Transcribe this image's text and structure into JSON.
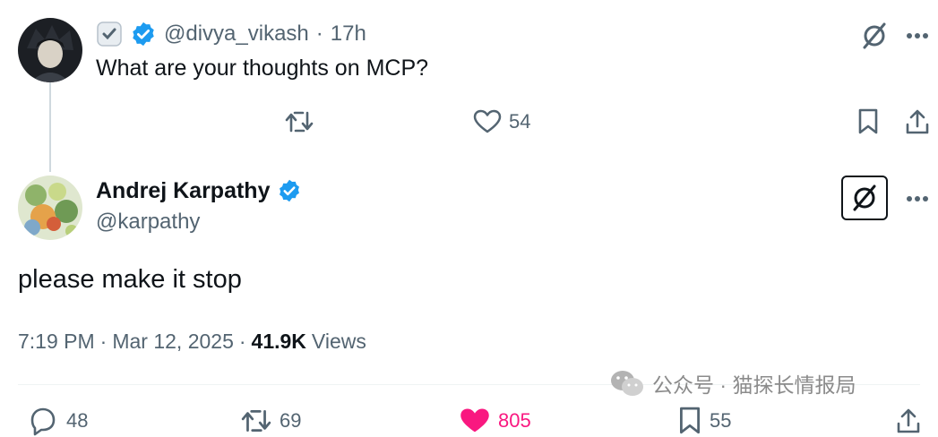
{
  "parent_tweet": {
    "handle": "@divya_vikash",
    "separator": "·",
    "time": "17h",
    "text": "What are your thoughts on MCP?",
    "likes": "54"
  },
  "main_tweet": {
    "name": "Andrej Karpathy",
    "handle": "@karpathy",
    "text": "please make it stop",
    "time": "7:19 PM",
    "sep1": "·",
    "date": "Mar 12, 2025",
    "sep2": "·",
    "views_count": "41.9K",
    "views_label": "Views"
  },
  "bottom_actions": {
    "replies": "48",
    "retweets": "69",
    "likes": "805",
    "bookmarks": "55"
  },
  "watermark": {
    "text": "公众号 · 猫探长情报局"
  },
  "colors": {
    "verified": "#1d9bf0",
    "like_active": "#f91880",
    "muted": "#536471"
  },
  "icons": [
    "verified-icon",
    "grok-icon",
    "more-icon",
    "retweet-icon",
    "heart-icon",
    "bookmark-icon",
    "share-icon",
    "reply-icon",
    "wechat-icon"
  ]
}
